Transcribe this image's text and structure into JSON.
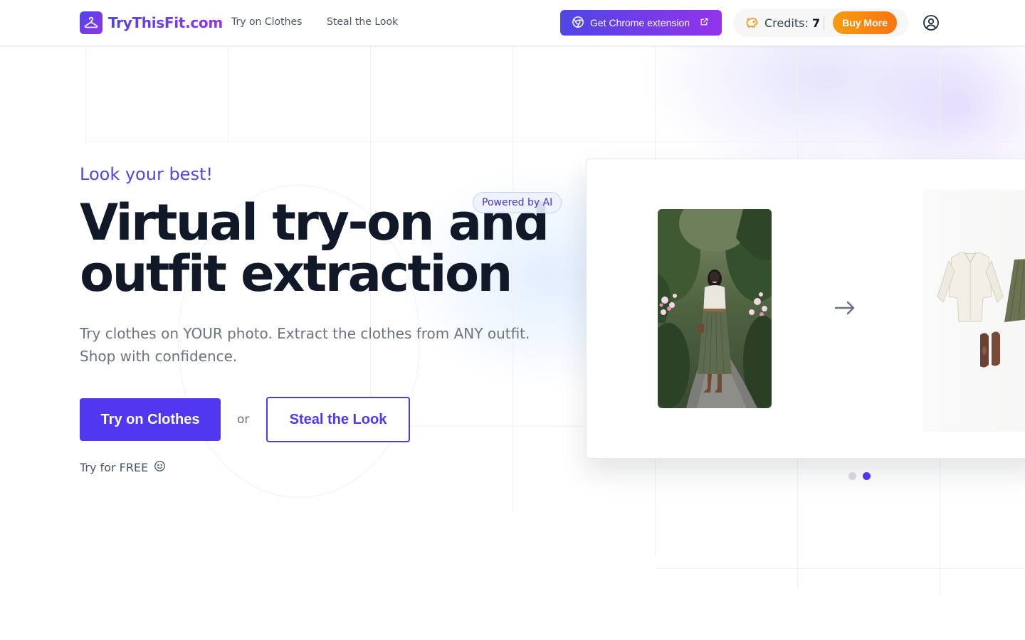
{
  "header": {
    "logo_text": "TryThisFit.com",
    "nav": [
      {
        "label": "Try on Clothes"
      },
      {
        "label": "Steal the Look"
      }
    ],
    "chrome_extension_label": "Get Chrome extension",
    "credits_label": "Credits:",
    "credits_value": "7",
    "buy_more_label": "Buy More"
  },
  "hero": {
    "tagline": "Look your best!",
    "badge": "Powered by AI",
    "headline_line1": "Virtual try-on and",
    "headline_line2": "outfit extraction",
    "subtitle": "Try clothes on YOUR photo. Extract the clothes from ANY outfit. Shop with confidence.",
    "primary_cta": "Try on Clothes",
    "or_text": "or",
    "secondary_cta": "Steal the Look",
    "free_note": "Try for FREE"
  },
  "carousel": {
    "slide_count": 2,
    "active_slide": 2
  },
  "colors": {
    "brand_indigo": "#4f38f0",
    "brand_purple": "#9333ea",
    "accent_orange": "#f97316",
    "text_dark": "#111827",
    "text_muted": "#6b7280"
  },
  "icons": [
    "hanger-icon",
    "chrome-icon",
    "external-link-icon",
    "coin-icon",
    "user-circle-icon",
    "arrow-right-icon",
    "smile-icon"
  ]
}
